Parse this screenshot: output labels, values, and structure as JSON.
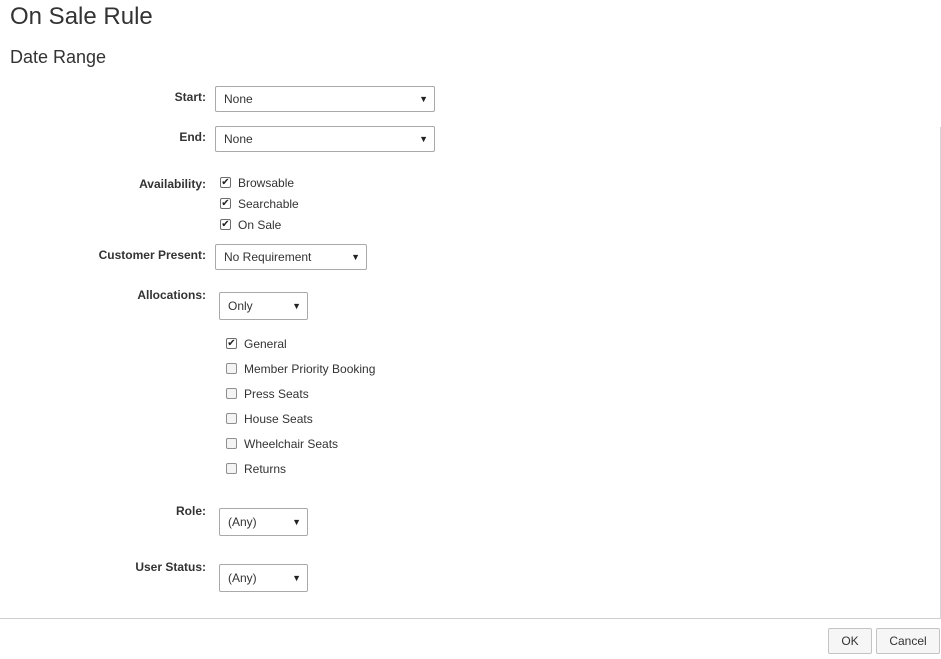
{
  "page": {
    "title": "On Sale Rule",
    "section": "Date Range"
  },
  "fields": {
    "start": {
      "label": "Start:",
      "value": "None"
    },
    "end": {
      "label": "End:",
      "value": "None"
    },
    "availability": {
      "label": "Availability:",
      "options": [
        {
          "label": "Browsable",
          "checked": true
        },
        {
          "label": "Searchable",
          "checked": true
        },
        {
          "label": "On Sale",
          "checked": true
        }
      ]
    },
    "customer_present": {
      "label": "Customer Present:",
      "value": "No Requirement"
    },
    "allocations": {
      "label": "Allocations:",
      "value": "Only",
      "options": [
        {
          "label": "General",
          "checked": true
        },
        {
          "label": "Member Priority Booking",
          "checked": false
        },
        {
          "label": "Press Seats",
          "checked": false
        },
        {
          "label": "House Seats",
          "checked": false
        },
        {
          "label": "Wheelchair Seats",
          "checked": false
        },
        {
          "label": "Returns",
          "checked": false
        }
      ]
    },
    "role": {
      "label": "Role:",
      "value": "(Any)"
    },
    "user_status": {
      "label": "User Status:",
      "value": "(Any)"
    }
  },
  "buttons": {
    "ok": "OK",
    "cancel": "Cancel"
  },
  "icons": {
    "dropdown": "caret-down-icon",
    "checkbox": "checkmark-icon"
  }
}
